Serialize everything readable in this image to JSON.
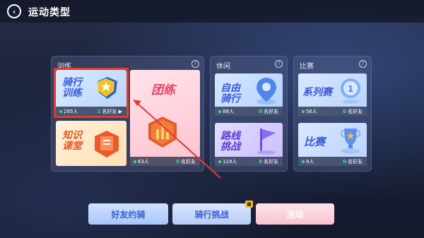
{
  "header": {
    "title": "运动类型",
    "back_icon": "‹"
  },
  "panels": {
    "training": {
      "title": "训练",
      "help": "?"
    },
    "leisure": {
      "title": "休闲",
      "help": "?"
    },
    "match": {
      "title": "比赛",
      "help": "?"
    }
  },
  "cards": {
    "ride_training": {
      "label_line1": "骑行",
      "label_line2": "训练",
      "count": "295人",
      "friends_num": "1",
      "friends_text": "名好友",
      "arrow": "▶"
    },
    "group_training": {
      "label": "团练",
      "count": "63人",
      "friends_num": "0",
      "friends_text": "名好友"
    },
    "knowledge_class": {
      "label_line1": "知识",
      "label_line2": "课堂"
    },
    "free_ride": {
      "label_line1": "自由",
      "label_line2": "骑行",
      "count": "88人",
      "friends_num": "0",
      "friends_text": "名好友"
    },
    "route_challenge": {
      "label_line1": "路线",
      "label_line2": "挑战",
      "count": "119人",
      "friends_num": "0",
      "friends_text": "名好友"
    },
    "series_match": {
      "label": "系列赛",
      "count": "56人",
      "friends_num": "0",
      "friends_text": "名好友"
    },
    "match": {
      "label": "比赛",
      "count": "9人",
      "friends_num": "0",
      "friends_text": "名好友"
    }
  },
  "bottom_buttons": {
    "friend_ride": "好友约骑",
    "ride_challenge": "骑行挑战",
    "activity": "活动"
  },
  "colors": {
    "accent_green": "#3ee07a",
    "highlight_red": "#e03c31",
    "label_blue": "#3a5bd9",
    "label_pink": "#e8456a",
    "label_orange": "#e35a2a"
  },
  "icons": {
    "back": "back-arrow-icon",
    "help": "question-circle-icon",
    "star_shield": "star-shield-icon",
    "tower": "bar-tower-icon",
    "book": "book-icon",
    "location_pin": "location-pin-icon",
    "flag": "flag-icon",
    "medal": "medal-icon",
    "trophy": "trophy-icon",
    "gift": "gift-icon"
  }
}
